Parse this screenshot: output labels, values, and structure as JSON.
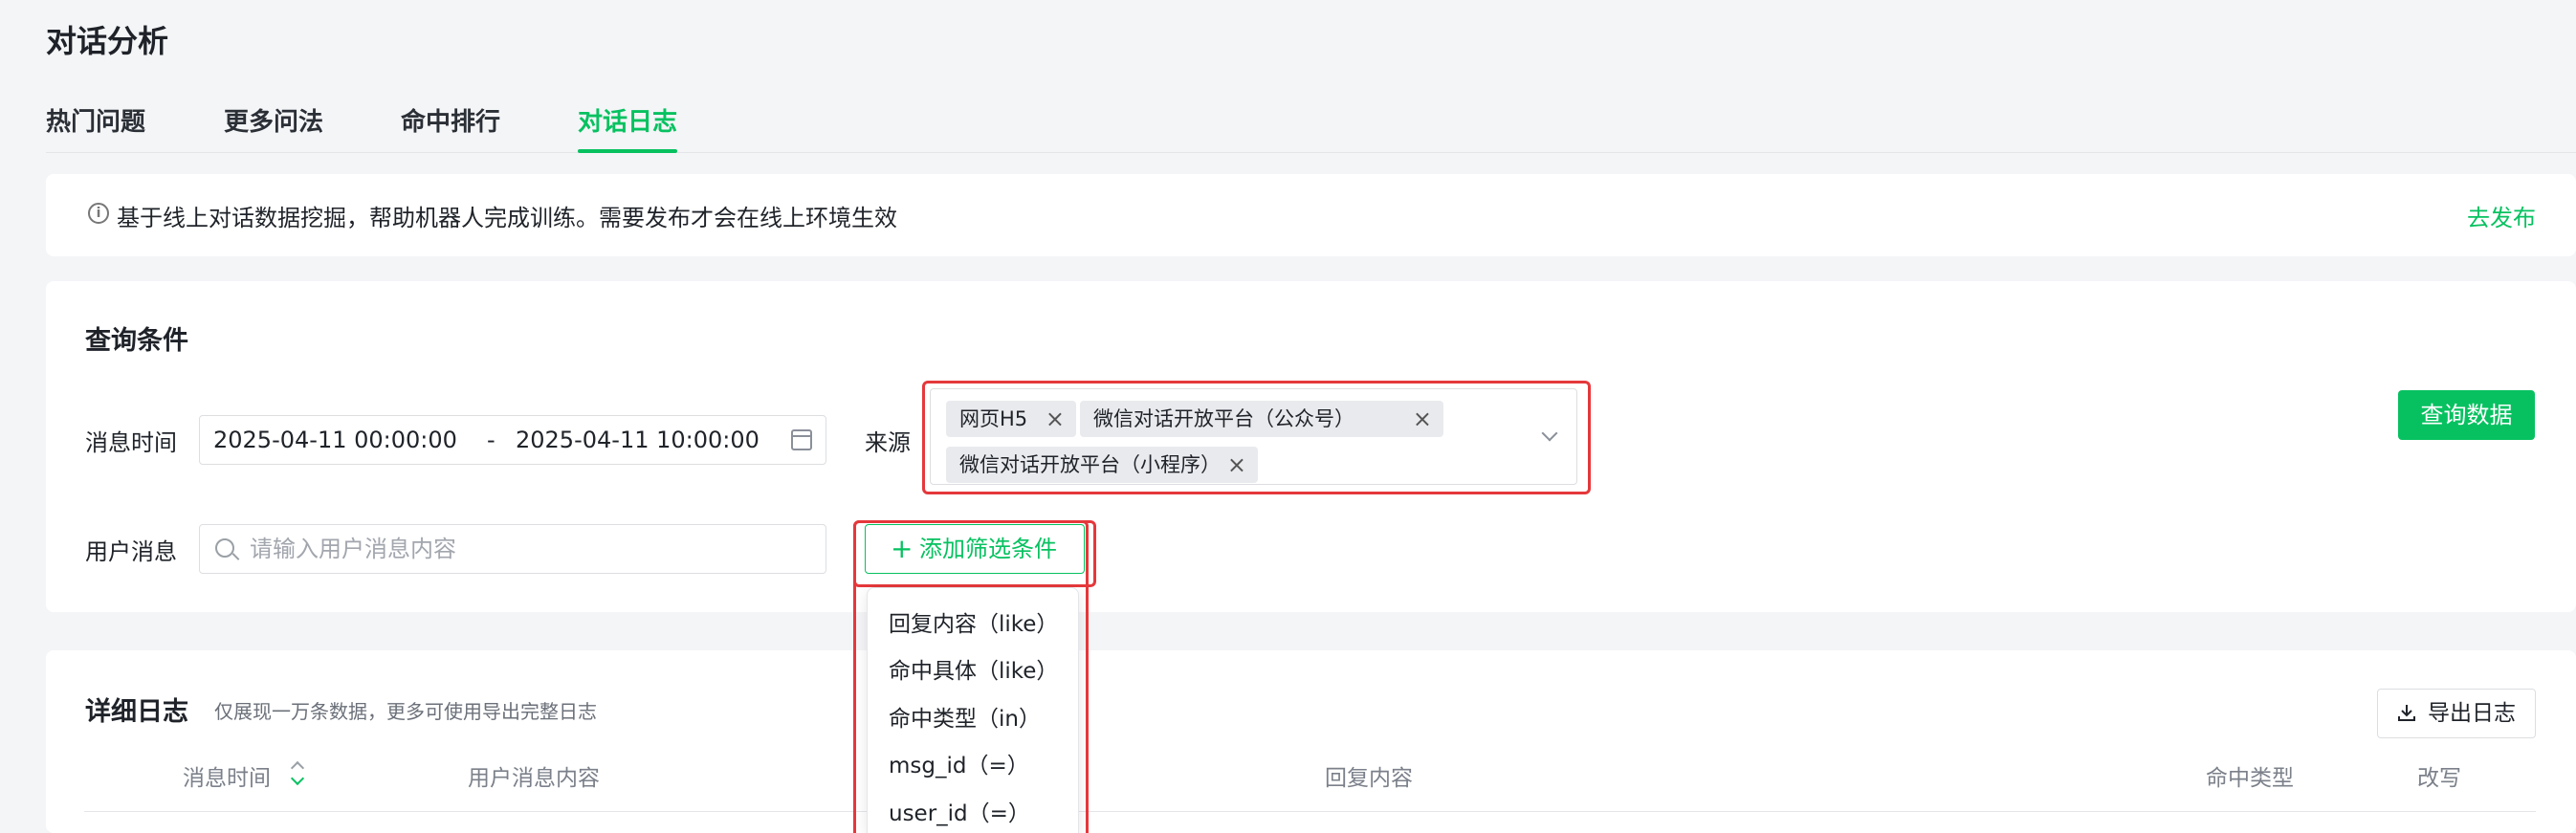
{
  "page": {
    "title": "对话分析"
  },
  "tabs": [
    {
      "label": "热门问题",
      "active": false
    },
    {
      "label": "更多问法",
      "active": false
    },
    {
      "label": "命中排行",
      "active": false
    },
    {
      "label": "对话日志",
      "active": true
    }
  ],
  "notice": {
    "icon": "info-icon",
    "text": "基于线上对话数据挖掘，帮助机器人完成训练。需要发布才会在线上环境生效",
    "publish_link": "去发布"
  },
  "query": {
    "title": "查询条件",
    "time_label": "消息时间",
    "start_time": "2025-04-11 00:00:00",
    "separator": "-",
    "end_time": "2025-04-11 10:00:00",
    "source_label": "来源",
    "source_tags": [
      "网页H5",
      "微信对话开放平台（公众号）",
      "微信对话开放平台（小程序）"
    ],
    "query_button": "查询数据",
    "message_label": "用户消息",
    "message_placeholder": "请输入用户消息内容",
    "add_filter_button": "添加筛选条件"
  },
  "filter_menu": {
    "items": [
      "回复内容（like）",
      "命中具体（like）",
      "命中类型（in）",
      "msg_id（=）",
      "user_id（=）"
    ]
  },
  "detail": {
    "title": "详细日志",
    "subtitle": "仅展现一万条数据，更多可使用导出完整日志",
    "export_button": "导出日志",
    "columns": [
      "消息时间",
      "用户消息内容",
      "回复内容",
      "命中类型",
      "改写"
    ]
  },
  "colors": {
    "accent": "#07c160",
    "highlight": "#e5383b"
  }
}
